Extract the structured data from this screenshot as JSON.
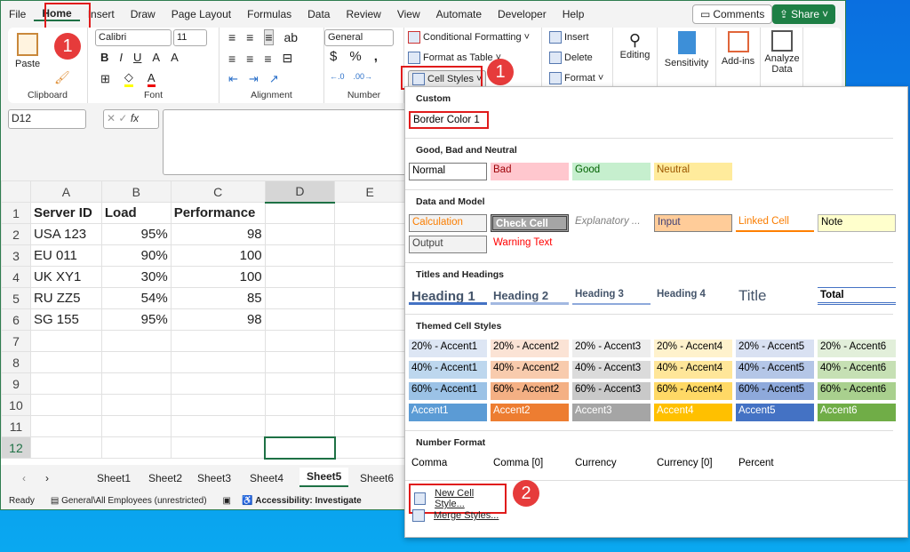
{
  "menu": [
    "File",
    "Home",
    "Insert",
    "Draw",
    "Page Layout",
    "Formulas",
    "Data",
    "Review",
    "View",
    "Automate",
    "Developer",
    "Help"
  ],
  "comments": "Comments",
  "share": "Share",
  "ribbon": {
    "paste": "Paste",
    "clipboard": "Clipboard",
    "font_name": "Calibri",
    "font_size": "11",
    "font": "Font",
    "alignment": "Alignment",
    "number_format": "General",
    "number": "Number",
    "cond_format": "Conditional Formatting",
    "format_table": "Format as Table",
    "cell_styles": "Cell Styles",
    "insert": "Insert",
    "delete": "Delete",
    "format": "Format",
    "editing": "Editing",
    "sensitivity": "Sensitivity",
    "addins": "Add-ins",
    "analyze": "Analyze Data"
  },
  "badges": {
    "one": "1",
    "two": "2"
  },
  "namebox": "D12",
  "columns": [
    "A",
    "B",
    "C",
    "D",
    "E"
  ],
  "rows": [
    [
      "Server ID",
      "Load",
      "Performance",
      "",
      ""
    ],
    [
      "USA 123",
      "95%",
      "98",
      "",
      ""
    ],
    [
      "EU 011",
      "90%",
      "100",
      "",
      ""
    ],
    [
      "UK XY1",
      "30%",
      "100",
      "",
      ""
    ],
    [
      "RU ZZ5",
      "54%",
      "85",
      "",
      ""
    ],
    [
      "SG 155",
      "95%",
      "98",
      "",
      ""
    ],
    [
      "",
      "",
      "",
      "",
      ""
    ],
    [
      "",
      "",
      "",
      "",
      ""
    ],
    [
      "",
      "",
      "",
      "",
      ""
    ],
    [
      "",
      "",
      "",
      "",
      ""
    ],
    [
      "",
      "",
      "",
      "",
      ""
    ],
    [
      "",
      "",
      "",
      "",
      ""
    ]
  ],
  "sheets": [
    "Sheet1",
    "Sheet2",
    "Sheet3",
    "Sheet4",
    "Sheet5",
    "Sheet6"
  ],
  "active_sheet": "Sheet5",
  "status": {
    "ready": "Ready",
    "label": "General\\All Employees (unrestricted)",
    "access": "Accessibility: Investigate"
  },
  "panel": {
    "sections": [
      "Custom",
      "Good, Bad and Neutral",
      "Data and Model",
      "Titles and Headings",
      "Themed Cell Styles",
      "Number Format"
    ],
    "custom": [
      {
        "label": "Border Color 1",
        "bg": "#ffffff",
        "fg": "#000000"
      }
    ],
    "good_bad": [
      {
        "label": "Normal",
        "bg": "#ffffff",
        "fg": "#000"
      },
      {
        "label": "Bad",
        "bg": "#ffc7ce",
        "fg": "#9c0006"
      },
      {
        "label": "Good",
        "bg": "#c6efce",
        "fg": "#006100"
      },
      {
        "label": "Neutral",
        "bg": "#ffeb9c",
        "fg": "#9c5700"
      }
    ],
    "data_model": [
      {
        "label": "Calculation",
        "bg": "#f2f2f2",
        "fg": "#fa7d00"
      },
      {
        "label": "Check Cell",
        "bg": "#a5a5a5",
        "fg": "#ffffff"
      },
      {
        "label": "Explanatory ...",
        "bg": "#ffffff",
        "fg": "#7f7f7f"
      },
      {
        "label": "Input",
        "bg": "#ffcc99",
        "fg": "#3f3f76"
      },
      {
        "label": "Linked Cell",
        "bg": "#ffffff",
        "fg": "#fa7d00"
      },
      {
        "label": "Note",
        "bg": "#ffffcc",
        "fg": "#000"
      },
      {
        "label": "Output",
        "bg": "#f2f2f2",
        "fg": "#3f3f3f"
      },
      {
        "label": "Warning Text",
        "bg": "#ffffff",
        "fg": "#ff0000"
      }
    ],
    "titles": [
      {
        "label": "Heading 1",
        "bg": "#fff",
        "fg": "#44546a"
      },
      {
        "label": "Heading 2",
        "bg": "#fff",
        "fg": "#44546a"
      },
      {
        "label": "Heading 3",
        "bg": "#fff",
        "fg": "#44546a"
      },
      {
        "label": "Heading 4",
        "bg": "#fff",
        "fg": "#44546a"
      },
      {
        "label": "Title",
        "bg": "#fff",
        "fg": "#44546a"
      },
      {
        "label": "Total",
        "bg": "#fff",
        "fg": "#000"
      }
    ],
    "themed": [
      [
        {
          "label": "20% - Accent1",
          "bg": "#dde6f4"
        },
        {
          "label": "20% - Accent2",
          "bg": "#fbe3d5"
        },
        {
          "label": "20% - Accent3",
          "bg": "#ededed"
        },
        {
          "label": "20% - Accent4",
          "bg": "#fff2cc"
        },
        {
          "label": "20% - Accent5",
          "bg": "#d9e1f2"
        },
        {
          "label": "20% - Accent6",
          "bg": "#e2efda"
        }
      ],
      [
        {
          "label": "40% - Accent1",
          "bg": "#bdd7ee"
        },
        {
          "label": "40% - Accent2",
          "bg": "#f8cbad"
        },
        {
          "label": "40% - Accent3",
          "bg": "#dbdbdb"
        },
        {
          "label": "40% - Accent4",
          "bg": "#ffe699"
        },
        {
          "label": "40% - Accent5",
          "bg": "#b4c6e7"
        },
        {
          "label": "40% - Accent6",
          "bg": "#c6e0b4"
        }
      ],
      [
        {
          "label": "60% - Accent1",
          "bg": "#9bc2e6"
        },
        {
          "label": "60% - Accent2",
          "bg": "#f4b084"
        },
        {
          "label": "60% - Accent3",
          "bg": "#c9c9c9"
        },
        {
          "label": "60% - Accent4",
          "bg": "#ffd966"
        },
        {
          "label": "60% - Accent5",
          "bg": "#8ea9db"
        },
        {
          "label": "60% - Accent6",
          "bg": "#a9d08e"
        }
      ],
      [
        {
          "label": "Accent1",
          "bg": "#5b9bd5",
          "fg": "#fff"
        },
        {
          "label": "Accent2",
          "bg": "#ed7d31",
          "fg": "#fff"
        },
        {
          "label": "Accent3",
          "bg": "#a5a5a5",
          "fg": "#fff"
        },
        {
          "label": "Accent4",
          "bg": "#ffc000",
          "fg": "#fff"
        },
        {
          "label": "Accent5",
          "bg": "#4472c4",
          "fg": "#fff"
        },
        {
          "label": "Accent6",
          "bg": "#70ad47",
          "fg": "#fff"
        }
      ]
    ],
    "number": [
      "Comma",
      "Comma [0]",
      "Currency",
      "Currency [0]",
      "Percent"
    ],
    "new_style": "New Cell Style...",
    "merge": "Merge Styles..."
  }
}
